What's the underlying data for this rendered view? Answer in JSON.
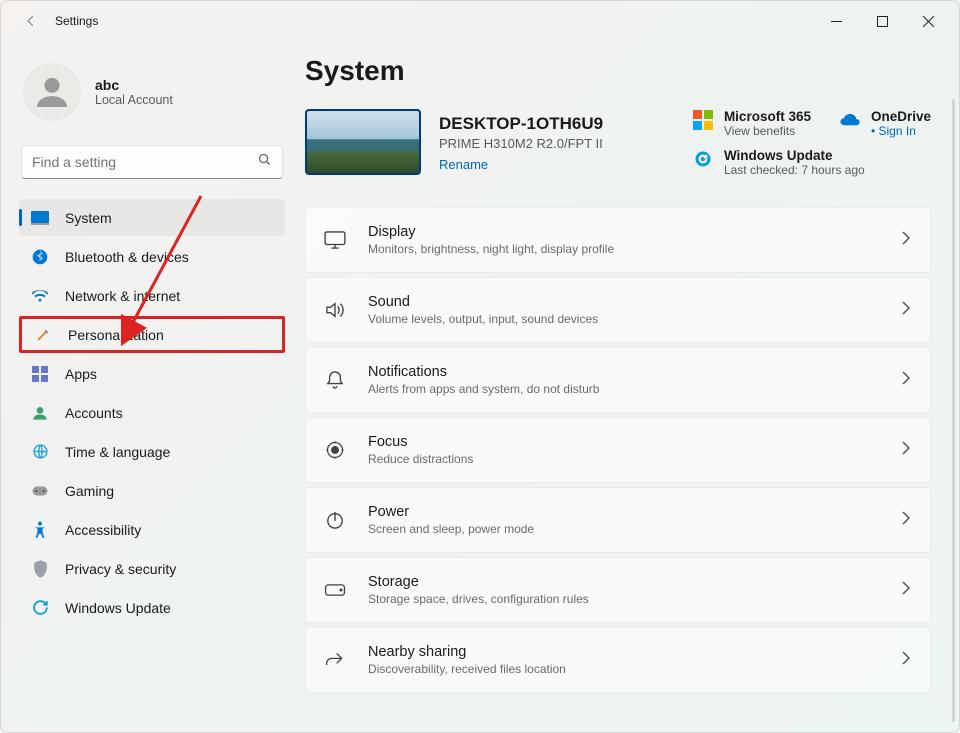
{
  "window": {
    "title": "Settings"
  },
  "user": {
    "name": "abc",
    "subtitle": "Local Account"
  },
  "search": {
    "placeholder": "Find a setting"
  },
  "sidebar": {
    "items": [
      {
        "label": "System",
        "icon": "system-icon",
        "active": true
      },
      {
        "label": "Bluetooth & devices",
        "icon": "bluetooth-icon"
      },
      {
        "label": "Network & internet",
        "icon": "wifi-icon"
      },
      {
        "label": "Personalization",
        "icon": "brush-icon",
        "highlighted": true
      },
      {
        "label": "Apps",
        "icon": "apps-icon"
      },
      {
        "label": "Accounts",
        "icon": "person-icon"
      },
      {
        "label": "Time & language",
        "icon": "globe-clock-icon"
      },
      {
        "label": "Gaming",
        "icon": "gamepad-icon"
      },
      {
        "label": "Accessibility",
        "icon": "accessibility-icon"
      },
      {
        "label": "Privacy & security",
        "icon": "shield-icon"
      },
      {
        "label": "Windows Update",
        "icon": "update-icon"
      }
    ]
  },
  "main": {
    "title": "System",
    "device": {
      "name": "DESKTOP-1OTH6U9",
      "model": "PRIME H310M2 R2.0/FPT II",
      "rename": "Rename"
    },
    "hero_cards": {
      "m365": {
        "title": "Microsoft 365",
        "subtitle": "View benefits"
      },
      "onedrive": {
        "title": "OneDrive",
        "subtitle": "Sign In"
      },
      "update": {
        "title": "Windows Update",
        "subtitle": "Last checked: 7 hours ago"
      }
    },
    "items": [
      {
        "title": "Display",
        "subtitle": "Monitors, brightness, night light, display profile",
        "icon": "display-icon"
      },
      {
        "title": "Sound",
        "subtitle": "Volume levels, output, input, sound devices",
        "icon": "sound-icon"
      },
      {
        "title": "Notifications",
        "subtitle": "Alerts from apps and system, do not disturb",
        "icon": "bell-icon"
      },
      {
        "title": "Focus",
        "subtitle": "Reduce distractions",
        "icon": "focus-icon"
      },
      {
        "title": "Power",
        "subtitle": "Screen and sleep, power mode",
        "icon": "power-icon"
      },
      {
        "title": "Storage",
        "subtitle": "Storage space, drives, configuration rules",
        "icon": "drive-icon"
      },
      {
        "title": "Nearby sharing",
        "subtitle": "Discoverability, received files location",
        "icon": "share-icon"
      }
    ]
  }
}
